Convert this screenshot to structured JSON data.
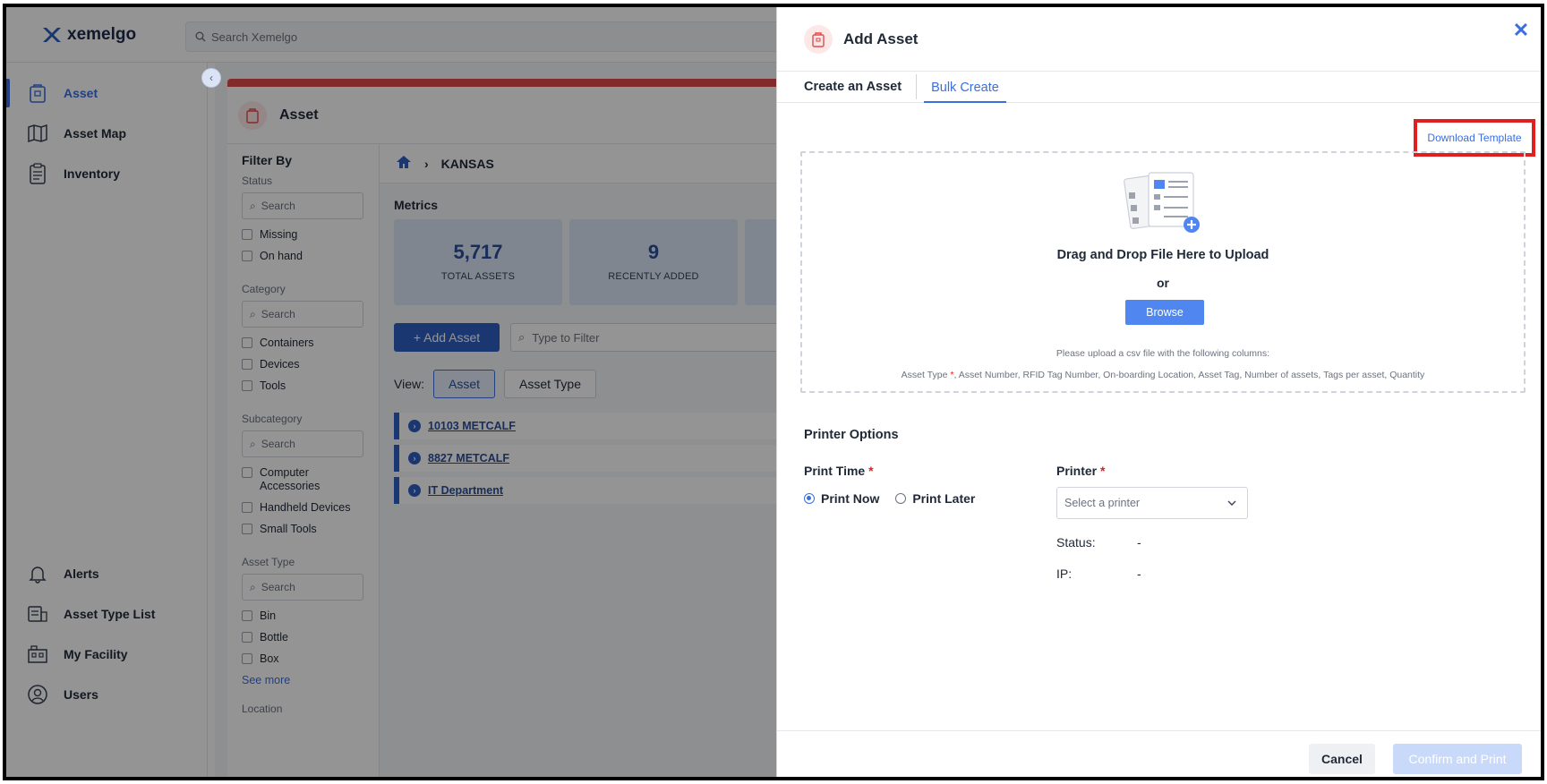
{
  "app": {
    "brand": "xemelgo",
    "search_placeholder": "Search Xemelgo"
  },
  "sidebar": {
    "collapse_icon": "chevron-left-icon",
    "items": [
      {
        "label": "Asset",
        "icon": "asset-icon",
        "active": true
      },
      {
        "label": "Asset Map",
        "icon": "map-icon",
        "active": false
      },
      {
        "label": "Inventory",
        "icon": "clipboard-icon",
        "active": false
      },
      {
        "label": "Alerts",
        "icon": "bell-icon",
        "active": false
      },
      {
        "label": "Asset Type List",
        "icon": "asset-type-list-icon",
        "active": false
      },
      {
        "label": "My Facility",
        "icon": "facility-icon",
        "active": false
      },
      {
        "label": "Users",
        "icon": "user-icon",
        "active": false
      }
    ]
  },
  "page": {
    "title": "Asset",
    "accent_color": "#e24b4b"
  },
  "filters": {
    "title": "Filter By",
    "sections": [
      {
        "name": "Status",
        "placeholder": "Search",
        "options": [
          "Missing",
          "On hand"
        ]
      },
      {
        "name": "Category",
        "placeholder": "Search",
        "options": [
          "Containers",
          "Devices",
          "Tools"
        ]
      },
      {
        "name": "Subcategory",
        "placeholder": "Search",
        "options": [
          "Computer Accessories",
          "Handheld Devices",
          "Small Tools"
        ]
      },
      {
        "name": "Asset Type",
        "placeholder": "Search",
        "options": [
          "Bin",
          "Bottle",
          "Box"
        ]
      }
    ],
    "see_more": "See more",
    "next_section": "Location"
  },
  "main": {
    "breadcrumb_home_icon": "home-icon",
    "breadcrumb_location": "KANSAS",
    "metrics_title": "Metrics",
    "metrics": [
      {
        "value": "5,717",
        "label": "TOTAL ASSETS"
      },
      {
        "value": "9",
        "label": "RECENTLY ADDED"
      }
    ],
    "add_asset_label": "+ Add Asset",
    "filter_placeholder": "Type to Filter",
    "view_label": "View:",
    "view_options": [
      "Asset",
      "Asset Type"
    ],
    "locations": [
      "10103 METCALF",
      "8827 METCALF",
      "IT Department"
    ]
  },
  "modal": {
    "title": "Add Asset",
    "close_icon": "close-icon",
    "tabs": [
      "Create an Asset",
      "Bulk Create"
    ],
    "active_tab": "Bulk Create",
    "download_template": "Download Template",
    "upload": {
      "title": "Drag and Drop File Here to Upload",
      "or": "or",
      "browse": "Browse",
      "instructions": "Please upload a csv file with the following columns:",
      "first_column": "Asset Type",
      "required_mark": "*",
      "other_columns": ", Asset Number, RFID Tag Number, On-boarding Location, Asset Tag, Number of assets, Tags per asset, Quantity"
    },
    "printer_options": {
      "title": "Printer Options",
      "print_time_label": "Print Time",
      "print_now": "Print Now",
      "print_later": "Print Later",
      "selected_time": "Print Now",
      "printer_label": "Printer",
      "printer_placeholder": "Select a printer",
      "status_label": "Status:",
      "status_value": "-",
      "ip_label": "IP:",
      "ip_value": "-"
    },
    "footer": {
      "cancel": "Cancel",
      "confirm": "Confirm and Print"
    },
    "colors": {
      "primary": "#3b6fe0",
      "required": "#e02020",
      "highlight_border": "#e02020"
    }
  }
}
